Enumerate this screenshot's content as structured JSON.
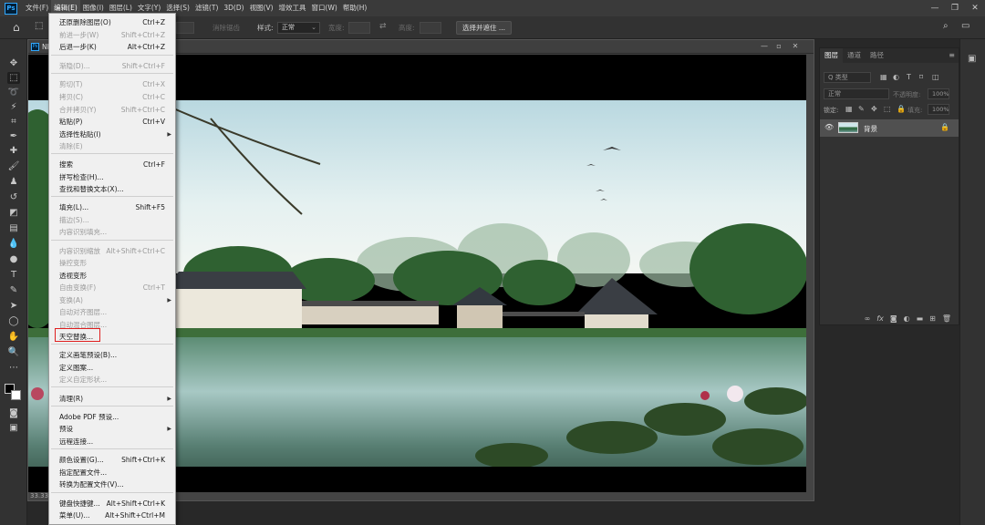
{
  "menubar": {
    "logo": "Ps",
    "items": [
      "文件(F)",
      "编辑(E)",
      "图像(I)",
      "图层(L)",
      "文字(Y)",
      "选择(S)",
      "滤镜(T)",
      "3D(D)",
      "视图(V)",
      "增效工具",
      "窗口(W)",
      "帮助(H)"
    ],
    "active_index": 1,
    "controls": [
      "—",
      "❐",
      "✕"
    ]
  },
  "options": {
    "anti_alias": "消除锯齿",
    "style_label": "样式:",
    "style_value": "正常",
    "width_label": "宽度:",
    "height_label": "高度:",
    "select_subject": "选择并遮住 ..."
  },
  "document": {
    "tab_prefix": "NE",
    "zoom": "33.33%"
  },
  "layers_panel": {
    "tabs": [
      "图层",
      "通道",
      "路径"
    ],
    "filter_label": "Q 类型",
    "blend_mode": "正常",
    "opacity_label": "不透明度:",
    "opacity_value": "100%",
    "lock_label": "锁定:",
    "fill_label": "填充:",
    "fill_value": "100%",
    "layer_name": "背景"
  },
  "edit_menu": {
    "items": [
      {
        "label": "还原删除图层(O)",
        "shortcut": "Ctrl+Z",
        "disabled": false,
        "submenu": false
      },
      {
        "label": "前进一步(W)",
        "shortcut": "Shift+Ctrl+Z",
        "disabled": true,
        "submenu": false
      },
      {
        "label": "后退一步(K)",
        "shortcut": "Alt+Ctrl+Z",
        "disabled": false,
        "submenu": false
      },
      {
        "label": "渐隐(D)...",
        "shortcut": "Shift+Ctrl+F",
        "disabled": true,
        "submenu": false
      },
      {
        "label": "剪切(T)",
        "shortcut": "Ctrl+X",
        "disabled": true,
        "submenu": false
      },
      {
        "label": "拷贝(C)",
        "shortcut": "Ctrl+C",
        "disabled": true,
        "submenu": false
      },
      {
        "label": "合并拷贝(Y)",
        "shortcut": "Shift+Ctrl+C",
        "disabled": true,
        "submenu": false
      },
      {
        "label": "粘贴(P)",
        "shortcut": "Ctrl+V",
        "disabled": false,
        "submenu": false
      },
      {
        "label": "选择性粘贴(I)",
        "shortcut": "",
        "disabled": false,
        "submenu": true
      },
      {
        "label": "清除(E)",
        "shortcut": "",
        "disabled": true,
        "submenu": false
      },
      {
        "label": "搜索",
        "shortcut": "Ctrl+F",
        "disabled": false,
        "submenu": false
      },
      {
        "label": "拼写检查(H)...",
        "shortcut": "",
        "disabled": false,
        "submenu": false
      },
      {
        "label": "查找和替换文本(X)...",
        "shortcut": "",
        "disabled": false,
        "submenu": false
      },
      {
        "label": "填充(L)...",
        "shortcut": "Shift+F5",
        "disabled": false,
        "submenu": false
      },
      {
        "label": "描边(S)...",
        "shortcut": "",
        "disabled": true,
        "submenu": false
      },
      {
        "label": "内容识别填充...",
        "shortcut": "",
        "disabled": true,
        "submenu": false
      },
      {
        "label": "内容识别缩放",
        "shortcut": "Alt+Shift+Ctrl+C",
        "disabled": true,
        "submenu": false
      },
      {
        "label": "操控变形",
        "shortcut": "",
        "disabled": true,
        "submenu": false
      },
      {
        "label": "透视变形",
        "shortcut": "",
        "disabled": false,
        "submenu": false
      },
      {
        "label": "自由变换(F)",
        "shortcut": "Ctrl+T",
        "disabled": true,
        "submenu": false
      },
      {
        "label": "变换(A)",
        "shortcut": "",
        "disabled": true,
        "submenu": true
      },
      {
        "label": "自动对齐图层...",
        "shortcut": "",
        "disabled": true,
        "submenu": false
      },
      {
        "label": "自动混合图层...",
        "shortcut": "",
        "disabled": true,
        "submenu": false
      },
      {
        "label": "天空替换...",
        "shortcut": "",
        "disabled": false,
        "submenu": false
      },
      {
        "label": "定义画笔预设(B)...",
        "shortcut": "",
        "disabled": false,
        "submenu": false
      },
      {
        "label": "定义图案...",
        "shortcut": "",
        "disabled": false,
        "submenu": false
      },
      {
        "label": "定义自定形状...",
        "shortcut": "",
        "disabled": true,
        "submenu": false
      },
      {
        "label": "清理(R)",
        "shortcut": "",
        "disabled": false,
        "submenu": true
      },
      {
        "label": "Adobe PDF 预设...",
        "shortcut": "",
        "disabled": false,
        "submenu": false
      },
      {
        "label": "预设",
        "shortcut": "",
        "disabled": false,
        "submenu": true
      },
      {
        "label": "远程连接...",
        "shortcut": "",
        "disabled": false,
        "submenu": false
      },
      {
        "label": "颜色设置(G)...",
        "shortcut": "Shift+Ctrl+K",
        "disabled": false,
        "submenu": false
      },
      {
        "label": "指定配置文件...",
        "shortcut": "",
        "disabled": false,
        "submenu": false
      },
      {
        "label": "转换为配置文件(V)...",
        "shortcut": "",
        "disabled": false,
        "submenu": false
      },
      {
        "label": "键盘快捷键...",
        "shortcut": "Alt+Shift+Ctrl+K",
        "disabled": false,
        "submenu": false
      },
      {
        "label": "菜单(U)...",
        "shortcut": "Alt+Shift+Ctrl+M",
        "disabled": false,
        "submenu": false
      }
    ],
    "highlighted_label": "天空替换..."
  },
  "colors": {
    "accent": "#31a8ff",
    "highlight_box": "#e02020"
  }
}
